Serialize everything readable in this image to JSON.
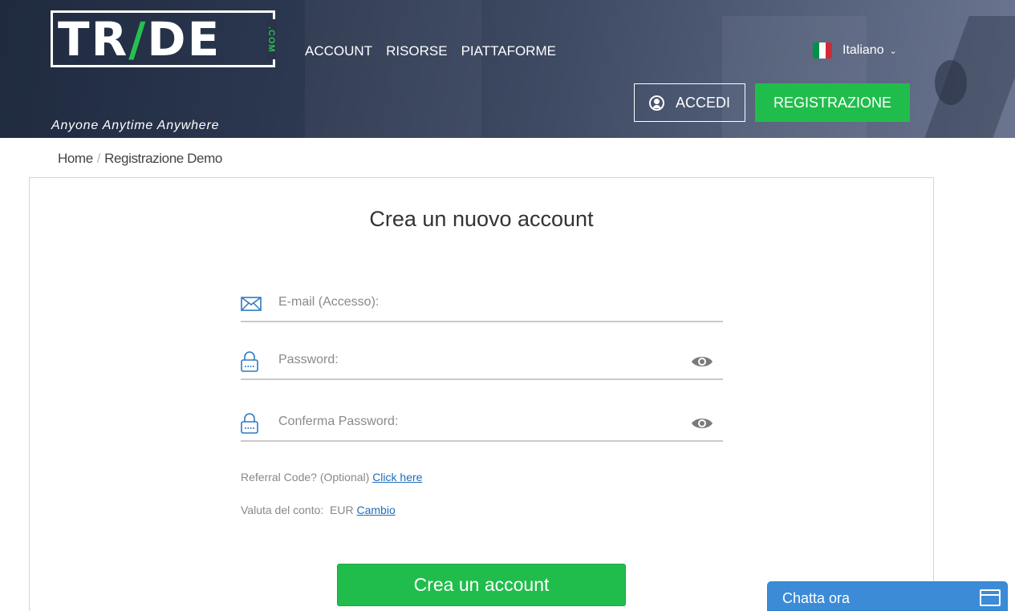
{
  "header": {
    "logo_text_pre": "TR",
    "logo_text_accent": "/",
    "logo_text_post": "DE",
    "logo_suffix": ".COM",
    "tagline": "Anyone Anytime Anywhere",
    "nav": [
      {
        "label": "ACCOUNT"
      },
      {
        "label": "RISORSE"
      },
      {
        "label": "PIATTAFORME"
      }
    ],
    "language": "Italiano",
    "flag_colors": [
      "#009246",
      "#ffffff",
      "#ce2b37"
    ],
    "login_label": "ACCEDI",
    "register_label": "REGISTRAZIONE"
  },
  "breadcrumb": {
    "home": "Home",
    "separator": "/",
    "current": "Registrazione Demo"
  },
  "form": {
    "title": "Crea un nuovo account",
    "email_placeholder": "E-mail (Accesso):",
    "email_value": "",
    "password_placeholder": "Password:",
    "password_value": "",
    "confirm_placeholder": "Conferma Password:",
    "confirm_value": "",
    "referral_text": "Referral Code? (Optional)",
    "referral_link": "Click here",
    "currency_label": "Valuta del conto:",
    "currency_value": "EUR",
    "currency_link": "Cambio",
    "submit_label": "Crea un account"
  },
  "chat": {
    "label": "Chatta ora"
  },
  "colors": {
    "brand_green": "#21bd4c",
    "link_blue": "#1e6db8",
    "chat_blue": "#3b8bd7",
    "icon_blue": "#2f78c4"
  }
}
